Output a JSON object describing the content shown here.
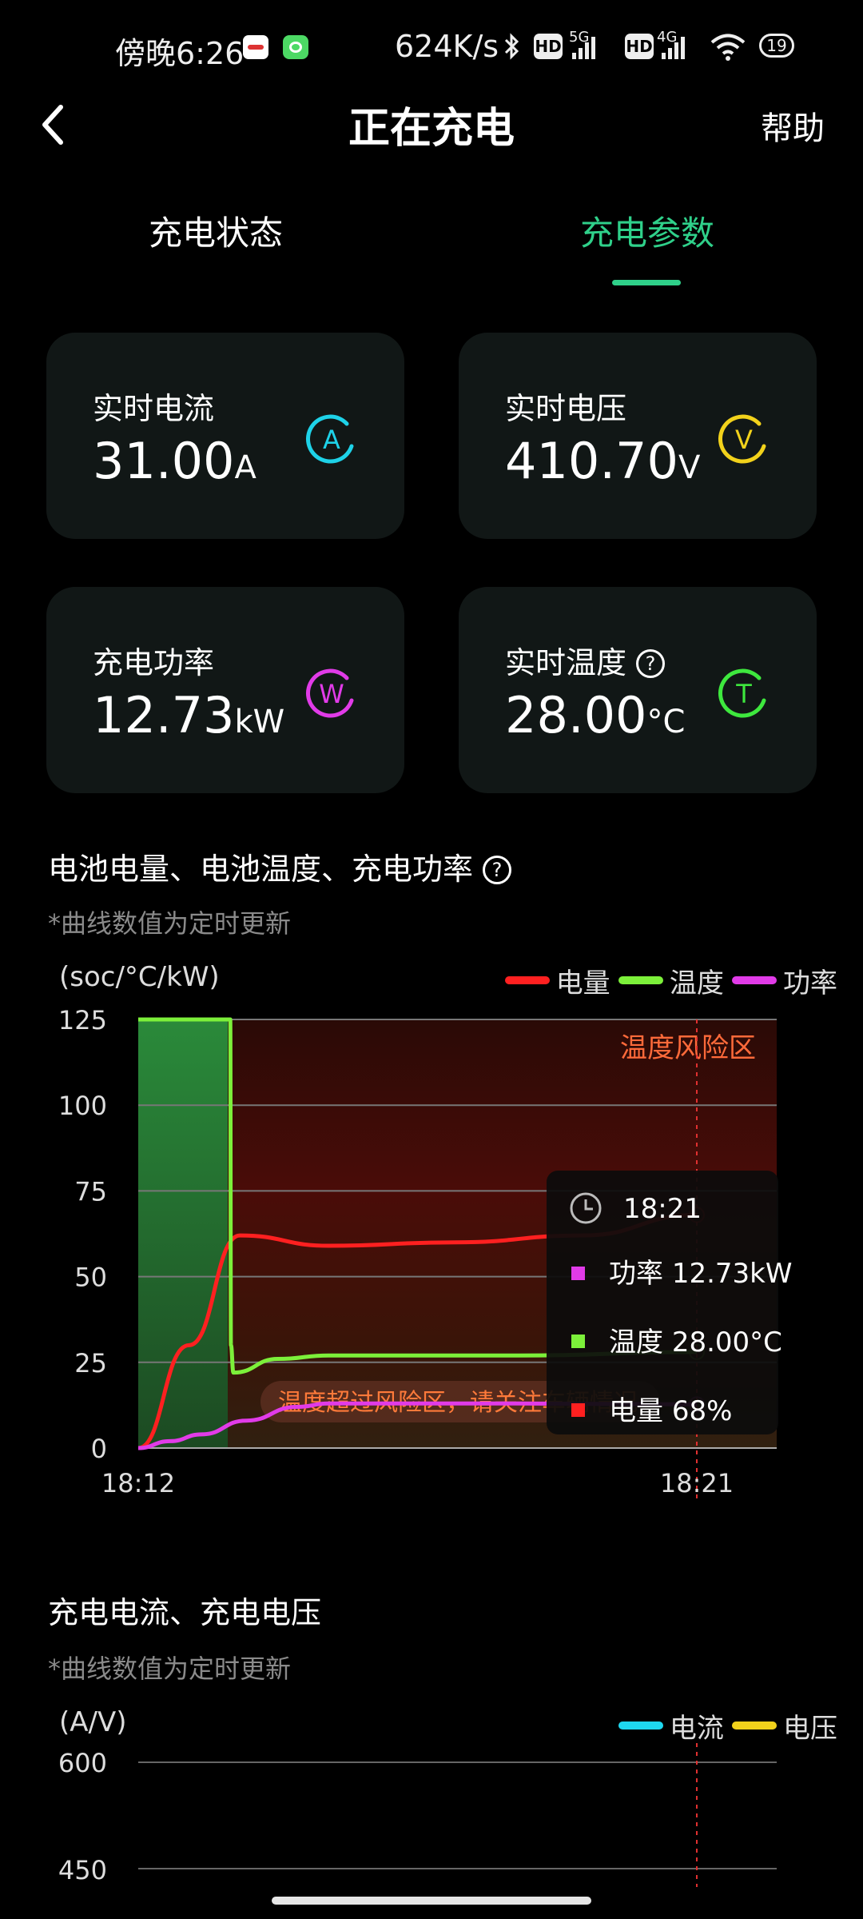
{
  "status_bar": {
    "time": "傍晚6:26",
    "net_speed": "624K/s",
    "hd_badge": "HD",
    "net_5g": "5G",
    "net_4g": "4G",
    "battery": "19"
  },
  "header": {
    "title": "正在充电",
    "help": "帮助"
  },
  "tabs": [
    {
      "label": "充电状态",
      "active": false
    },
    {
      "label": "充电参数",
      "active": true
    }
  ],
  "cards": {
    "current": {
      "label": "实时电流",
      "value": "31.00",
      "unit": "A",
      "icon_letter": "A",
      "color": "#1ed2e8"
    },
    "voltage": {
      "label": "实时电压",
      "value": "410.70",
      "unit": "V",
      "icon_letter": "V",
      "color": "#f2d21b"
    },
    "power": {
      "label": "充电功率",
      "value": "12.73",
      "unit": "kW",
      "icon_letter": "W",
      "color": "#e13be8"
    },
    "temperature": {
      "label": "实时温度",
      "value": "28.00",
      "unit": "°C",
      "icon_letter": "T",
      "color": "#3ee83e",
      "help_mark": "?"
    }
  },
  "section1": {
    "title": "电池电量、电池温度、充电功率",
    "help_mark": "?",
    "note": "*曲线数值为定时更新"
  },
  "section2": {
    "title": "充电电流、充电电压",
    "note": "*曲线数值为定时更新"
  },
  "chart_data": [
    {
      "type": "line",
      "unit_label": "(soc/°C/kW)",
      "ylim": [
        0,
        125
      ],
      "yticks": [
        "125",
        "100",
        "75",
        "50",
        "25",
        "0"
      ],
      "x_tick_labels": [
        "18:12",
        "18:21"
      ],
      "legend_placement": "top-right",
      "grid": true,
      "zone_label": "温度风险区",
      "warning_text": "温度超过风险区，请关注车辆情况",
      "series": [
        {
          "name": "电量",
          "color": "#ff2020",
          "x": [
            0,
            0.08,
            0.16,
            0.3,
            0.5,
            0.7,
            0.88
          ],
          "values": [
            0,
            30,
            62,
            59,
            60,
            62,
            68
          ]
        },
        {
          "name": "温度",
          "color": "#7cf03a",
          "x": [
            0,
            0.145,
            0.146,
            0.15,
            0.22,
            0.3,
            0.6,
            0.88
          ],
          "values": [
            125,
            125,
            30,
            22,
            26,
            27,
            27,
            28
          ]
        },
        {
          "name": "功率",
          "color": "#e13be8",
          "x": [
            0,
            0.05,
            0.1,
            0.17,
            0.25,
            0.3,
            0.6,
            0.88
          ],
          "values": [
            0,
            2,
            4,
            8,
            12,
            13,
            13,
            12.73
          ]
        }
      ],
      "tooltip": {
        "time": "18:21",
        "rows": [
          {
            "label": "功率",
            "value": "12.73kW",
            "color": "#e13be8"
          },
          {
            "label": "温度",
            "value": "28.00°C",
            "color": "#7cf03a"
          },
          {
            "label": "电量",
            "value": "68%",
            "color": "#ff2020"
          }
        ]
      }
    },
    {
      "type": "line",
      "unit_label": "(A/V)",
      "yticks": [
        "600",
        "450"
      ],
      "legend_placement": "top-right",
      "grid": true,
      "series": [
        {
          "name": "电流",
          "color": "#1ed8f0"
        },
        {
          "name": "电压",
          "color": "#f2d21b"
        }
      ]
    }
  ]
}
